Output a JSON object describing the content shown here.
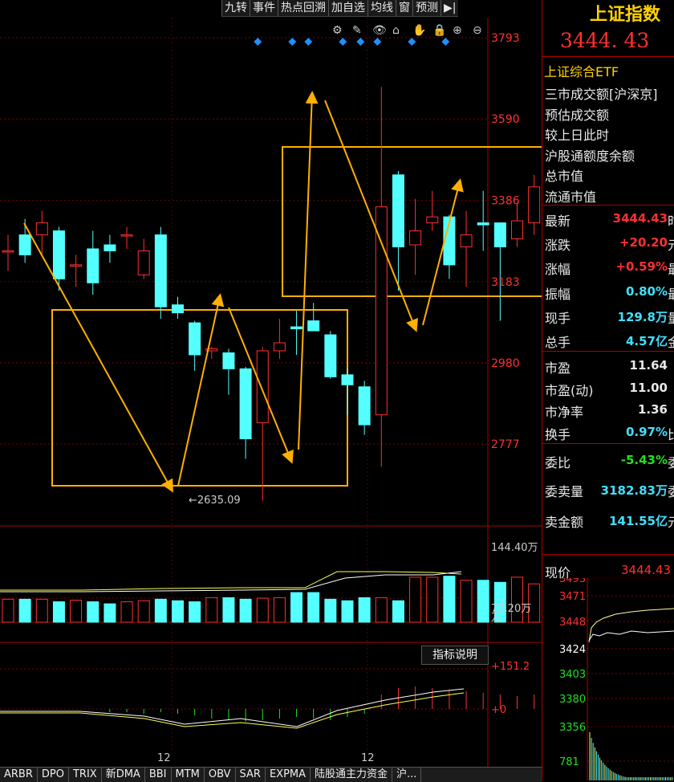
{
  "toolbar": {
    "items": [
      "九转",
      "事件",
      "热点回溯",
      "加自选",
      "均线",
      "窗",
      "预测"
    ]
  },
  "main_chart": {
    "price_ticks": [
      "3793",
      "3590",
      "3386",
      "3183",
      "2980",
      "2777"
    ],
    "low_annotation": "←2635.09",
    "volume_ticks": [
      "144.40万",
      "72.20万",
      "万"
    ],
    "indicator_ticks": [
      "+151.2",
      "+0"
    ],
    "indicator_button": "指标说明",
    "x_labels": [
      "12",
      "12"
    ]
  },
  "chart_data": {
    "type": "candlestick",
    "ylim": [
      2560,
      3860
    ],
    "candles": [
      {
        "o": 3260,
        "c": 3260,
        "h": 3300,
        "l": 3210
      },
      {
        "o": 3300,
        "c": 3250,
        "h": 3340,
        "l": 3230
      },
      {
        "o": 3300,
        "c": 3330,
        "h": 3360,
        "l": 3250
      },
      {
        "o": 3310,
        "c": 3190,
        "h": 3320,
        "l": 3160
      },
      {
        "o": 3225,
        "c": 3225,
        "h": 3250,
        "l": 3170
      },
      {
        "o": 3265,
        "c": 3180,
        "h": 3310,
        "l": 3150
      },
      {
        "o": 3275,
        "c": 3260,
        "h": 3300,
        "l": 3230
      },
      {
        "o": 3300,
        "c": 3300,
        "h": 3320,
        "l": 3265
      },
      {
        "o": 3200,
        "c": 3260,
        "h": 3290,
        "l": 3190
      },
      {
        "o": 3300,
        "c": 3120,
        "h": 3320,
        "l": 3090
      },
      {
        "o": 3125,
        "c": 3105,
        "h": 3145,
        "l": 3090
      },
      {
        "o": 3080,
        "c": 3000,
        "h": 3085,
        "l": 2960
      },
      {
        "o": 3010,
        "c": 3015,
        "h": 3020,
        "l": 2990
      },
      {
        "o": 3005,
        "c": 2965,
        "h": 3015,
        "l": 2900
      },
      {
        "o": 2965,
        "c": 2790,
        "h": 2970,
        "l": 2740
      },
      {
        "o": 2830,
        "c": 3010,
        "h": 3020,
        "l": 2635
      },
      {
        "o": 3010,
        "c": 3030,
        "h": 3090,
        "l": 2990
      },
      {
        "o": 3070,
        "c": 3065,
        "h": 3110,
        "l": 3000
      },
      {
        "o": 3085,
        "c": 3060,
        "h": 3130,
        "l": 3060
      },
      {
        "o": 3050,
        "c": 2945,
        "h": 3060,
        "l": 2940
      },
      {
        "o": 2950,
        "c": 2925,
        "h": 2965,
        "l": 2850
      },
      {
        "o": 2920,
        "c": 2825,
        "h": 2935,
        "l": 2800
      },
      {
        "o": 2850,
        "c": 3370,
        "h": 3670,
        "l": 2720
      },
      {
        "o": 3450,
        "c": 3270,
        "h": 3460,
        "l": 3160
      },
      {
        "o": 3275,
        "c": 3310,
        "h": 3390,
        "l": 3200
      },
      {
        "o": 3330,
        "c": 3345,
        "h": 3410,
        "l": 3310
      },
      {
        "o": 3345,
        "c": 3225,
        "h": 3350,
        "l": 3190
      },
      {
        "o": 3270,
        "c": 3300,
        "h": 3360,
        "l": 3170
      },
      {
        "o": 3330,
        "c": 3325,
        "h": 3410,
        "l": 3260
      },
      {
        "o": 3330,
        "c": 3270,
        "h": 3330,
        "l": 3085
      },
      {
        "o": 3290,
        "c": 3335,
        "h": 3380,
        "l": 3270
      },
      {
        "o": 3330,
        "c": 3420,
        "h": 3450,
        "l": 3300
      }
    ],
    "volume": {
      "ylim": [
        0,
        144.4
      ],
      "values": [
        45,
        45,
        45,
        40,
        43,
        40,
        36,
        40,
        42,
        45,
        42,
        40,
        48,
        48,
        45,
        47,
        48,
        58,
        58,
        45,
        42,
        48,
        48,
        42,
        88,
        88,
        90,
        82,
        82,
        78,
        88,
        75
      ]
    }
  },
  "right_panel": {
    "title": "上证指数",
    "price": "3444. 43",
    "etf": "上证综合ETF",
    "stats": [
      "三市成交额[沪深京]",
      "预估成交额",
      "较上日此时",
      "沪股通额度余额",
      "总市值",
      "流通市值"
    ],
    "quotes": [
      {
        "label": "最新",
        "value": "3444.43",
        "color": "#ff3030"
      },
      {
        "label": "涨跌",
        "value": "+20.20",
        "color": "#ff3030"
      },
      {
        "label": "涨幅",
        "value": "+0.59%",
        "color": "#ff3030"
      },
      {
        "label": "振幅",
        "value": "0.80%",
        "color": "#40e0ff"
      },
      {
        "label": "现手",
        "value": "129.8万",
        "color": "#40e0ff"
      },
      {
        "label": "总手",
        "value": "4.57亿",
        "color": "#40e0ff"
      },
      {
        "label": "市盈",
        "value": "11.64",
        "color": "#e8e8e8"
      },
      {
        "label": "市盈(动)",
        "value": "11.00",
        "color": "#e8e8e8"
      },
      {
        "label": "市净率",
        "value": "1.36",
        "color": "#e8e8e8"
      },
      {
        "label": "换手",
        "value": "0.97%",
        "color": "#40e0ff"
      },
      {
        "label": "委比",
        "value": "-5.43%",
        "color": "#20e020"
      },
      {
        "label": "委卖量",
        "value": "3182.83万",
        "color": "#40e0ff"
      },
      {
        "label": "卖金额",
        "value": "141.55亿",
        "color": "#40e0ff"
      }
    ],
    "trailing": [
      "时",
      "元",
      "最",
      "最",
      "量",
      "金",
      "",
      "",
      "",
      "比",
      "委",
      "委",
      "元"
    ],
    "mini": {
      "label": "现价",
      "value": "3444.43",
      "ticks": [
        "3493",
        "3471",
        "3448",
        "3424",
        "3403",
        "3380",
        "3356",
        "781"
      ]
    }
  },
  "tabs": [
    "ARBR",
    "DPO",
    "TRIX",
    "新DMA",
    "BBI",
    "MTM",
    "OBV",
    "SAR",
    "EXPMA",
    "陆股通主力资金",
    "沪..."
  ]
}
